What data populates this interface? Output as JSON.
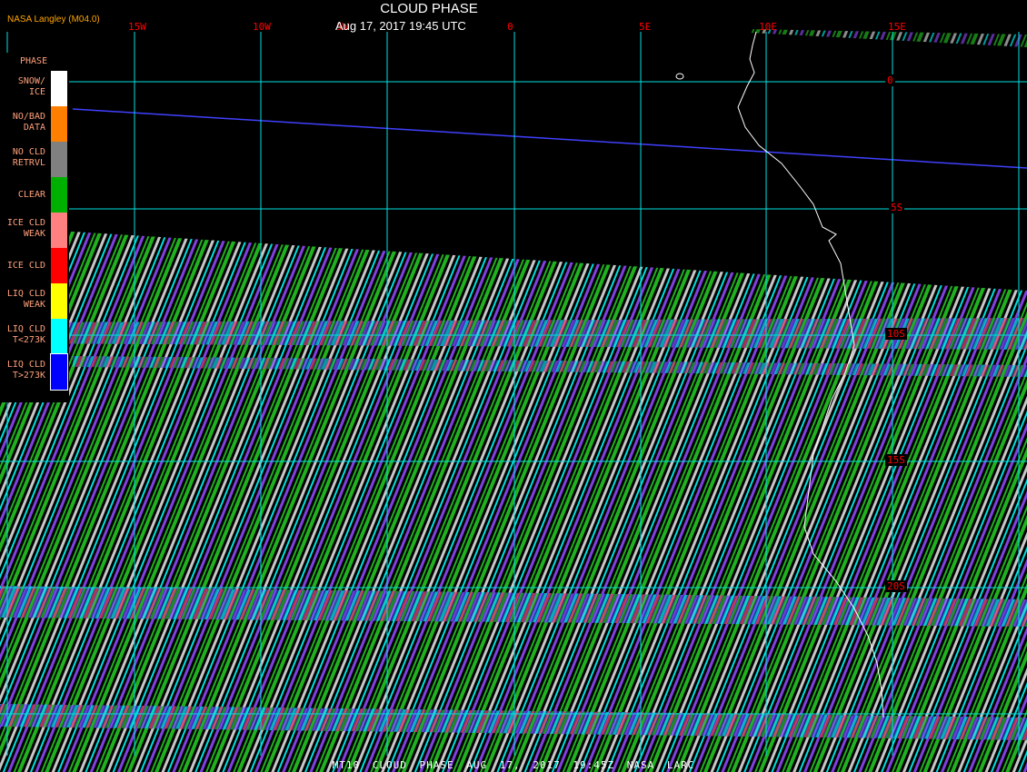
{
  "header": {
    "title": "CLOUD PHASE",
    "datetime": "Aug 17, 2017 19:45 UTC",
    "source": "NASA Langley (M04.0)"
  },
  "grid": {
    "longitude_labels": [
      "15W",
      "10W",
      "5W",
      "0",
      "5E",
      "10E",
      "15E"
    ],
    "latitude_labels": [
      "0",
      "5S",
      "10S",
      "15S",
      "20S"
    ]
  },
  "legend": {
    "title": "PHASE",
    "items": [
      {
        "label": "SNOW/\nICE",
        "color": "#ffffff"
      },
      {
        "label": "NO/BAD\nDATA",
        "color": "#ff8000"
      },
      {
        "label": "NO CLD\nRETRVL",
        "color": "#808080"
      },
      {
        "label": "CLEAR",
        "color": "#00b000"
      },
      {
        "label": "ICE CLD\nWEAK",
        "color": "#ff8080"
      },
      {
        "label": "ICE CLD",
        "color": "#ff0000"
      },
      {
        "label": "LIQ CLD\nWEAK",
        "color": "#ffff00"
      },
      {
        "label": "LIQ CLD\nT<273K",
        "color": "#00ffff"
      },
      {
        "label": "LIQ CLD\nT>273K",
        "color": "#0000ff"
      }
    ]
  },
  "footer": "MT10   CLOUD PHASE   AUG 17, 2017 19:45Z   NASA LARC"
}
